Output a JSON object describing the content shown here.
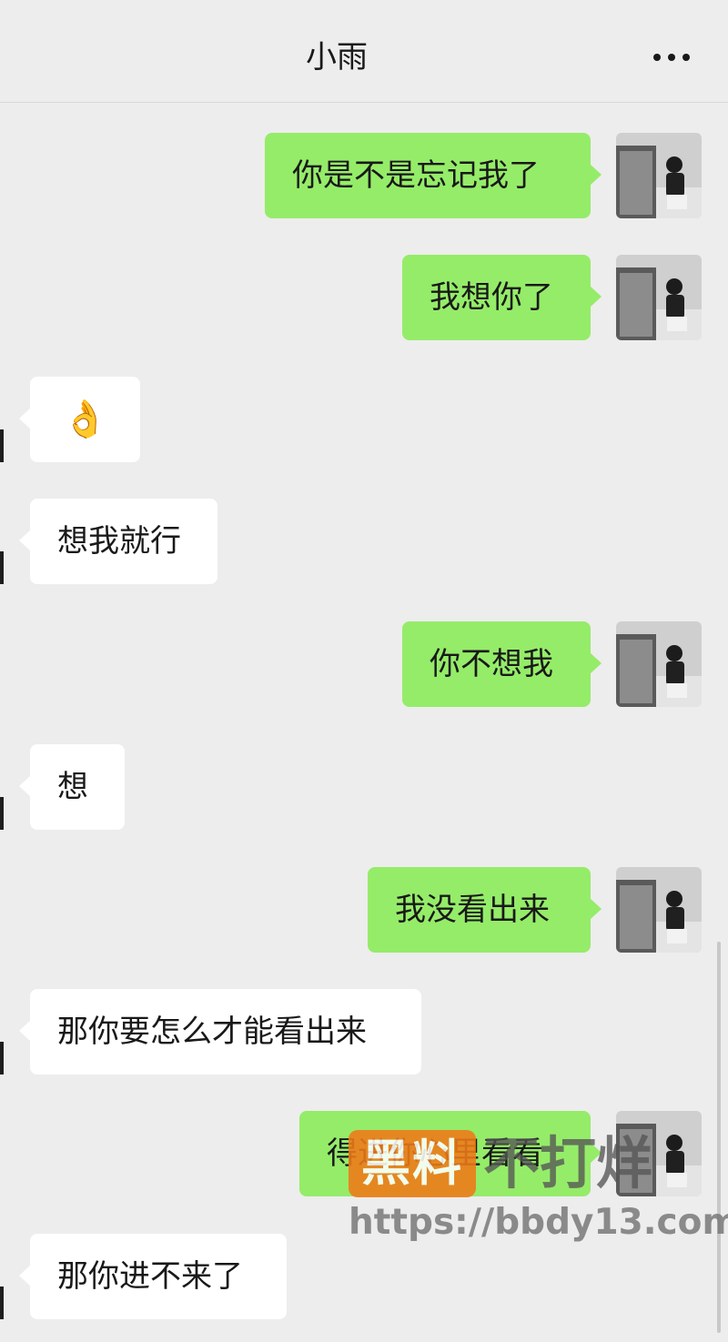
{
  "header": {
    "title": "小雨"
  },
  "icons": {
    "more": "more-dots-icon",
    "avatar_self": "avatar-photo",
    "avatar_other": "avatar-photo"
  },
  "colors": {
    "background": "#ededed",
    "sent_bubble": "#95ec69",
    "received_bubble": "#ffffff"
  },
  "messages": [
    {
      "side": "right",
      "text": "你是不是忘记我了"
    },
    {
      "side": "right",
      "text": "我想你了"
    },
    {
      "side": "left",
      "text": "👌"
    },
    {
      "side": "left",
      "text": "想我就行"
    },
    {
      "side": "right",
      "text": "你不想我"
    },
    {
      "side": "left",
      "text": "想"
    },
    {
      "side": "right",
      "text": "我没看出来"
    },
    {
      "side": "left",
      "text": "那你要怎么才能看出来"
    },
    {
      "side": "right",
      "text": "得进你心里看看"
    },
    {
      "side": "left",
      "text": "那你进不来了"
    }
  ],
  "watermark": {
    "badge": "黑料",
    "text": "不打烊",
    "url": "https://bbdy13.com"
  }
}
